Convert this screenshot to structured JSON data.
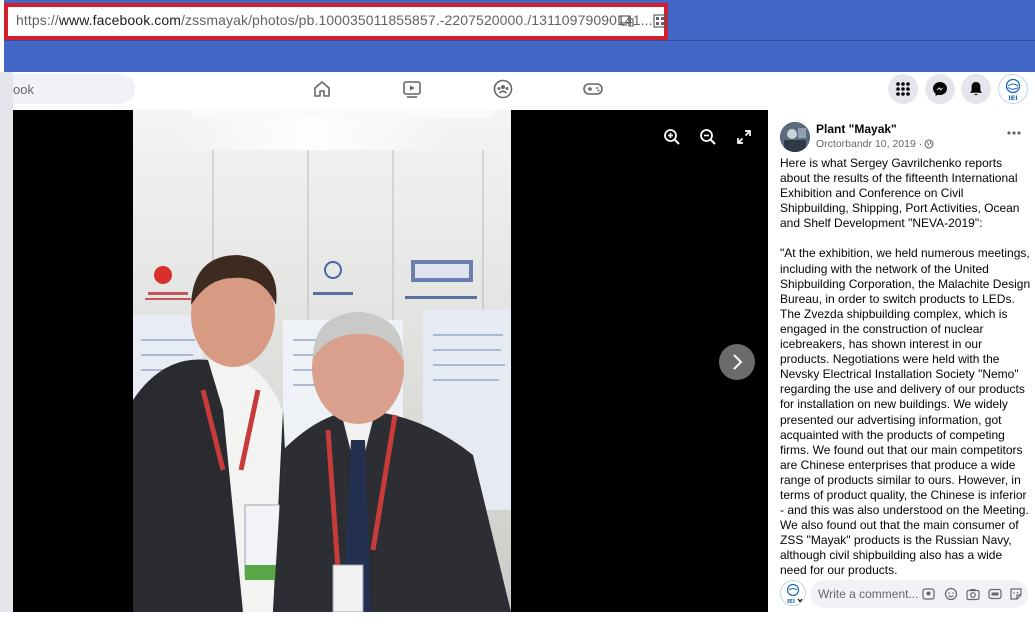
{
  "browser": {
    "url_prefix": "https://",
    "url_host": "www.facebook.com",
    "url_path": "/zssmayak/photos/pb.100035011855857.-2207520000./13110979090141..."
  },
  "fbnav": {
    "search_text": "ook",
    "account_badge": "IEI"
  },
  "post": {
    "page_name": "Plant \"Mayak\"",
    "date": "Orctorbandr 10, 2019 ·",
    "paragraph_1": "Here is what Sergey Gavrilchenko reports about the results of the fifteenth International Exhibition and Conference on Civil Shipbuilding, Shipping, Port Activities, Ocean and Shelf Development \"NEVA-2019\":",
    "paragraph_2": "\"At the exhibition, we held numerous meetings, including with the network of the United Shipbuilding Corporation, the Malachite Design Bureau, in order to switch products to LEDs. The Zvezda shipbuilding complex, which is engaged in the construction of nuclear icebreakers, has shown interest in our products. Negotiations were held with the Nevsky Electrical Installation Society \"Nemo\" regarding the use and delivery of our products for installation on new buildings. We widely presented our advertising information, got acquainted with the products of competing firms. We found out that our main competitors are Chinese enterprises that produce a wide range of products similar to ours. However, in terms of product quality, the Chinese is inferior - and this was also understood on the Meeting. We also found out that the main consumer of ZSS \"Mayak\" products is the Russian Navy, although civil shipbuilding also has a wide need for our products."
  },
  "comment": {
    "placeholder": "Write a comment...",
    "avatar_badge": "IEI"
  },
  "colors": {
    "browser_band": "#4267c6",
    "highlight_border": "#d21f2b",
    "viewer_bg": "#000000"
  }
}
